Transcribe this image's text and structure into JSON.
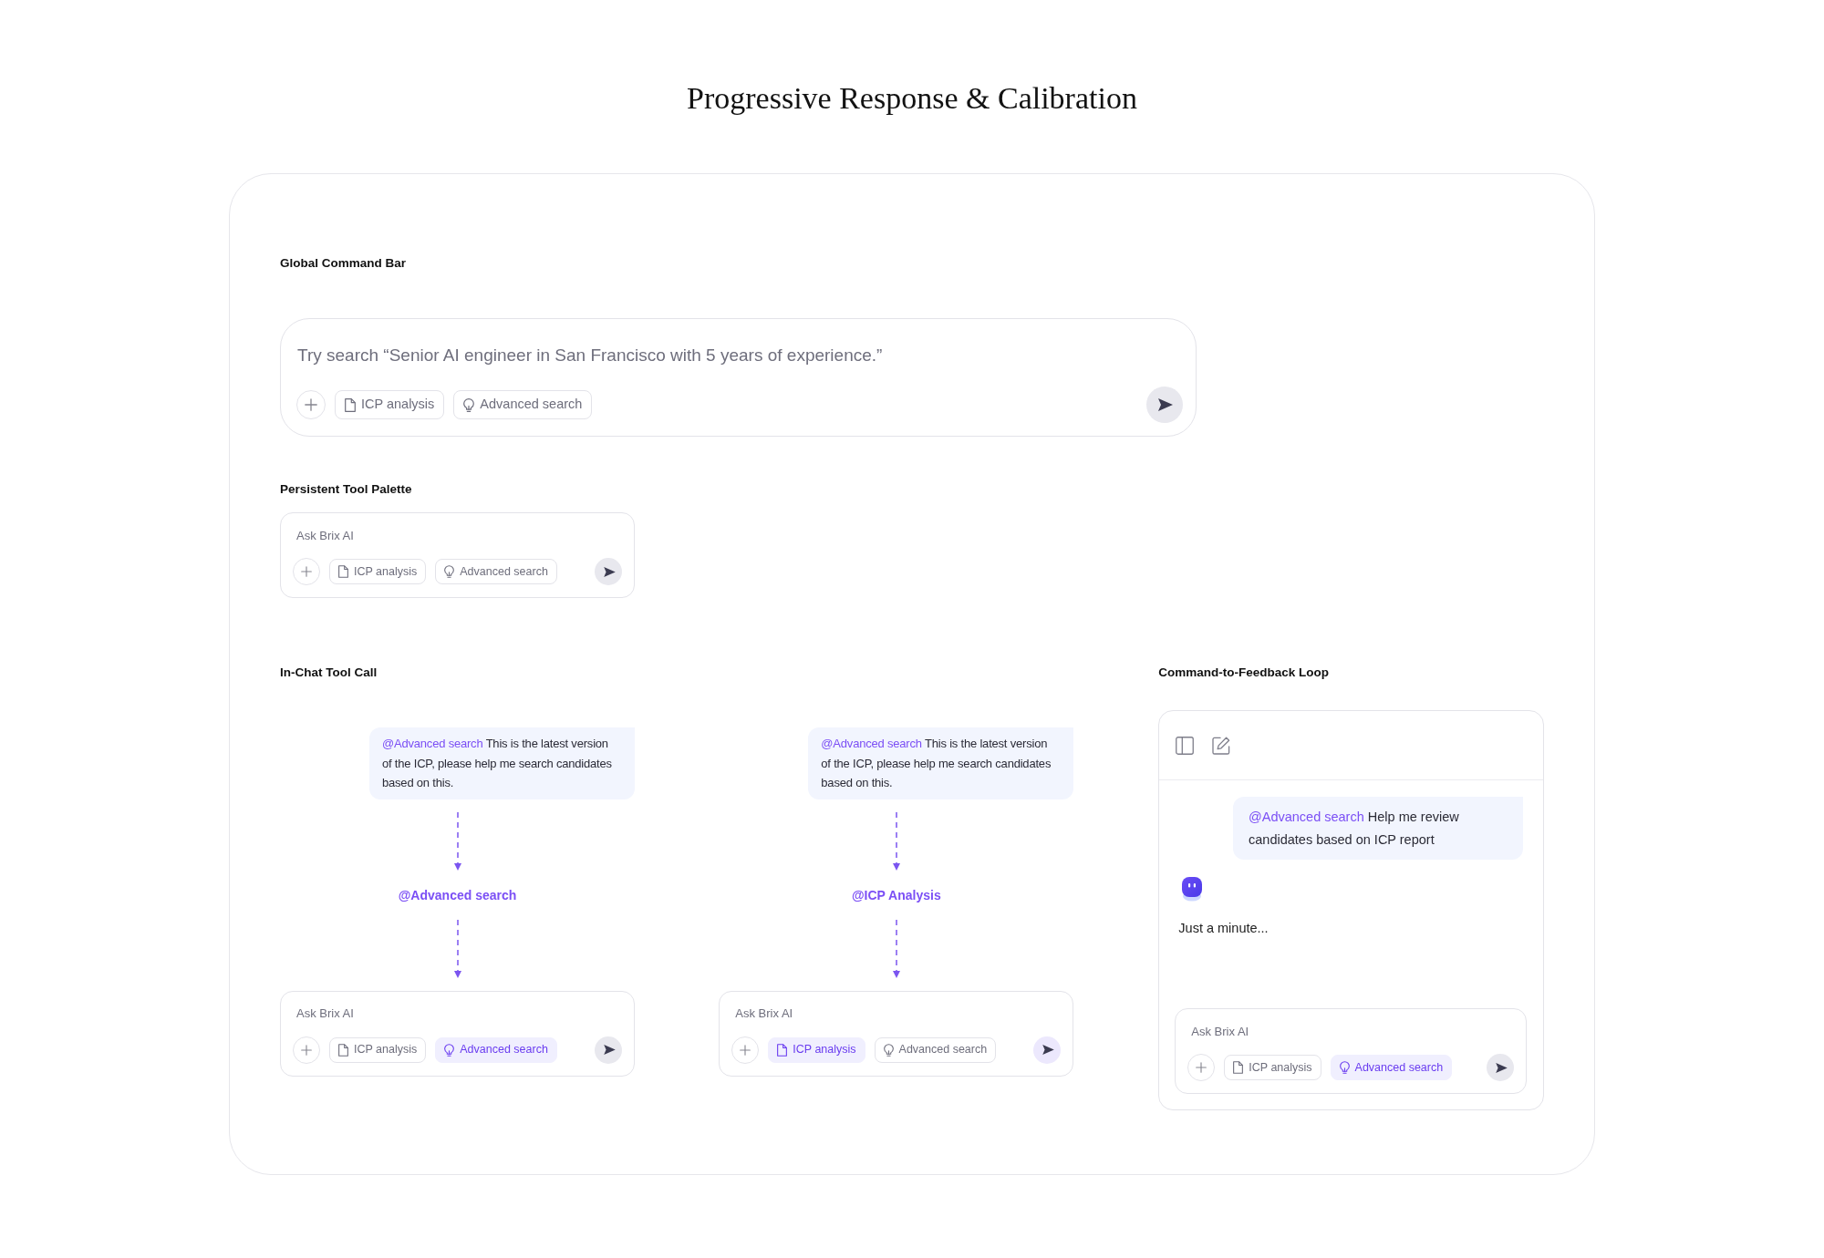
{
  "page_title": "Progressive Response & Calibration",
  "global_command_bar": {
    "heading": "Global Command Bar",
    "composer": {
      "placeholder": "Try search “Senior AI engineer in San Francisco with 5 years of experience.”",
      "tools": [
        {
          "kind": "file",
          "label": "ICP analysis",
          "selected": false
        },
        {
          "kind": "bulb",
          "label": "Advanced search",
          "selected": false
        }
      ],
      "send_highlighted": false
    }
  },
  "persistent_tool_palette": {
    "heading": "Persistent Tool Palette",
    "composer": {
      "placeholder": "Ask Brix AI",
      "tools": [
        {
          "kind": "file",
          "label": "ICP analysis",
          "selected": false
        },
        {
          "kind": "bulb",
          "label": "Advanced search",
          "selected": false
        }
      ],
      "send_highlighted": false
    }
  },
  "in_chat_tool_call": {
    "heading": "In-Chat Tool Call",
    "flows": [
      {
        "message": {
          "mention": "@Advanced search",
          "text": "This is the latest version of the ICP, please help me search candidates based on this."
        },
        "tool_call": "@Advanced search",
        "composer": {
          "placeholder": "Ask Brix AI",
          "tools": [
            {
              "kind": "file",
              "label": "ICP analysis",
              "selected": false
            },
            {
              "kind": "bulb",
              "label": "Advanced search",
              "selected": true
            }
          ],
          "send_highlighted": false
        }
      },
      {
        "message": {
          "mention": "@Advanced search",
          "text": "This is the latest version of the ICP, please help me search candidates based on this."
        },
        "tool_call": "@ICP Analysis",
        "composer": {
          "placeholder": "Ask Brix AI",
          "tools": [
            {
              "kind": "file",
              "label": "ICP analysis",
              "selected": true
            },
            {
              "kind": "bulb",
              "label": "Advanced search",
              "selected": false
            }
          ],
          "send_highlighted": true
        }
      }
    ]
  },
  "command_to_feedback_loop": {
    "heading": "Command-to-Feedback Loop",
    "message": {
      "mention": "@Advanced search",
      "text": "Help me review candidates based on ICP report"
    },
    "reply": "Just a minute...",
    "composer": {
      "placeholder": "Ask Brix AI",
      "tools": [
        {
          "kind": "file",
          "label": "ICP analysis",
          "selected": false
        },
        {
          "kind": "bulb",
          "label": "Advanced search",
          "selected": true
        }
      ],
      "send_highlighted": false
    }
  }
}
